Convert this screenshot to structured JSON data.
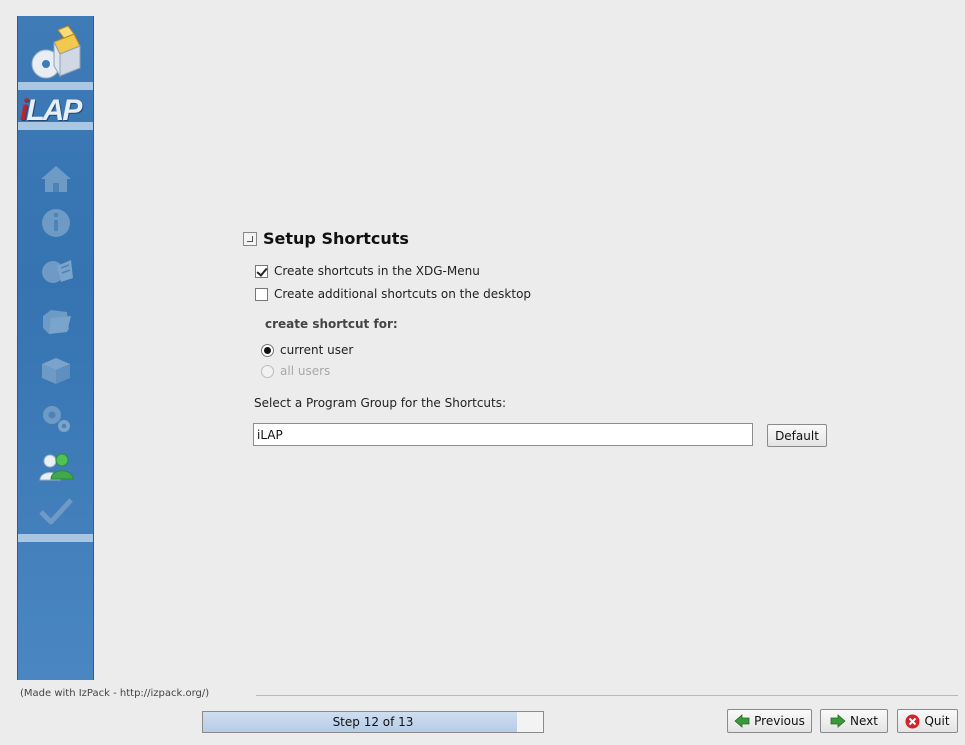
{
  "sidebar": {
    "brand_prefix": "i",
    "brand_rest": "LAP",
    "steps": [
      {
        "icon": "home-icon",
        "active": false
      },
      {
        "icon": "info-icon",
        "active": false
      },
      {
        "icon": "license-icon",
        "active": false
      },
      {
        "icon": "folder-icon",
        "active": false
      },
      {
        "icon": "packages-icon",
        "active": false
      },
      {
        "icon": "gears-icon",
        "active": false
      },
      {
        "icon": "users-icon",
        "active": true
      },
      {
        "icon": "checkmark-icon",
        "active": false
      }
    ]
  },
  "panel": {
    "title": "Setup Shortcuts",
    "xdg_menu_label": "Create shortcuts in the XDG-Menu",
    "xdg_menu_checked": true,
    "desktop_label": "Create additional shortcuts on the desktop",
    "desktop_checked": false,
    "shortcut_for_label": "create shortcut for:",
    "current_user_label": "current user",
    "all_users_label": "all users",
    "selected_target": "current user",
    "program_group_label": "Select a Program Group for the Shortcuts:",
    "program_group_value": "iLAP",
    "default_button": "Default"
  },
  "footer": {
    "made_with": "(Made with IzPack - http://izpack.org/)",
    "step_text": "Step 12 of 13",
    "progress_fraction": 0.923,
    "previous_button": "Previous",
    "next_button": "Next",
    "quit_button": "Quit"
  },
  "colors": {
    "sidebar_blue": "#3e7bb7",
    "sidebar_band": "#a9c6e2",
    "active_icon_green": "#3ea84a",
    "progress_fill": "#b6cce7",
    "quit_red": "#d2232a",
    "nav_green": "#3a9a3a"
  }
}
